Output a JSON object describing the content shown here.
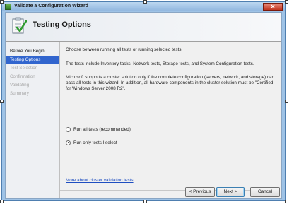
{
  "window": {
    "title": "Validate a Configuration Wizard",
    "close_glyph": "✕"
  },
  "header": {
    "title": "Testing Options",
    "icon": "validation-checklist-icon"
  },
  "nav": {
    "items": [
      {
        "label": "Before You Begin",
        "state": "normal"
      },
      {
        "label": "Testing Options",
        "state": "active"
      },
      {
        "label": "Test Selection",
        "state": "disabled"
      },
      {
        "label": "Confirmation",
        "state": "disabled"
      },
      {
        "label": "Validating",
        "state": "disabled"
      },
      {
        "label": "Summary",
        "state": "disabled"
      }
    ]
  },
  "content": {
    "intro": "Choose between running all tests or running selected tests.",
    "tests_info": "The tests include Inventory tasks, Network tests, Storage tests, and System Configuration tests.",
    "support_info": "Microsoft supports a cluster solution only if the complete configuration (servers, network, and storage) can pass all tests in this wizard. In addition, all hardware components in the cluster solution must be \"Certified for Windows Server 2008 R2\".",
    "options": [
      {
        "label": "Run all tests (recommended)",
        "checked": false
      },
      {
        "label": "Run only tests I select",
        "checked": true
      }
    ],
    "link": "More about cluster validation tests"
  },
  "buttons": {
    "previous": "< Previous",
    "next": "Next >",
    "cancel": "Cancel"
  },
  "colors": {
    "active_nav": "#3165ce",
    "link": "#1e4ec1",
    "frame": "#9fc3e6"
  }
}
